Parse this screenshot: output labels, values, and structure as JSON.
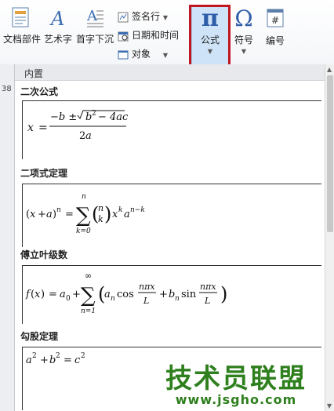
{
  "ribbon": {
    "doc_parts": "文档部件",
    "wordart": "艺术字",
    "drop_cap": "首字下沉",
    "signature_line": "签名行",
    "date_time": "日期和时间",
    "object": "对象",
    "equation": "公式",
    "equation_glyph": "π",
    "symbol": "符号",
    "symbol_glyph": "Ω",
    "number": "编号",
    "number_glyph": "#"
  },
  "ruler": {
    "number": "38"
  },
  "gallery": {
    "header": "内置",
    "sections": [
      {
        "title": "二次公式"
      },
      {
        "title": "二项式定理"
      },
      {
        "title": "傅立叶级数"
      },
      {
        "title": "勾股定理"
      }
    ]
  },
  "watermark": {
    "text": "技术员联盟",
    "url": "www.jsgho.com"
  },
  "colors": {
    "highlight": "#c0161d",
    "watermark": "#2e7f1d",
    "selected": "#cfe3f8"
  }
}
